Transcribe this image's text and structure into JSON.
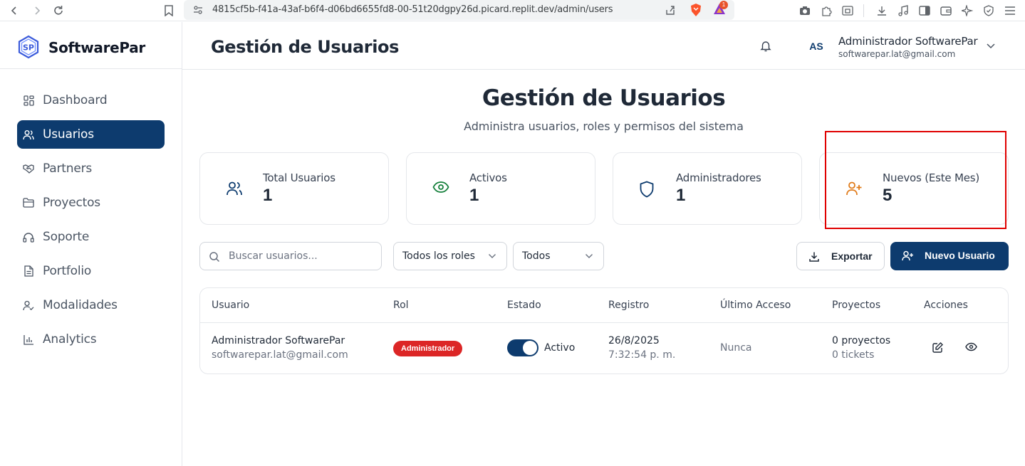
{
  "browser": {
    "url": "4815cf5b-f41a-43af-b6f4-d06bd6655fd8-00-51t20dgpy26d.picard.replit.dev/admin/users",
    "rewards_badge": "1"
  },
  "brand": {
    "name": "SoftwarePar",
    "logo_text": "SP"
  },
  "sidebar": {
    "items": [
      {
        "label": "Dashboard",
        "icon": "grid-icon"
      },
      {
        "label": "Usuarios",
        "icon": "users-icon",
        "active": true
      },
      {
        "label": "Partners",
        "icon": "handshake-icon"
      },
      {
        "label": "Proyectos",
        "icon": "folder-icon"
      },
      {
        "label": "Soporte",
        "icon": "headphones-icon"
      },
      {
        "label": "Portfolio",
        "icon": "document-icon"
      },
      {
        "label": "Modalidades",
        "icon": "user-check-icon"
      },
      {
        "label": "Analytics",
        "icon": "bar-chart-icon"
      }
    ]
  },
  "header": {
    "title": "Gestión de Usuarios",
    "avatar_initials": "AS",
    "user_name": "Administrador SoftwarePar",
    "user_email": "softwarepar.lat@gmail.com"
  },
  "page": {
    "title": "Gestión de Usuarios",
    "subtitle": "Administra usuarios, roles y permisos del sistema"
  },
  "stats": [
    {
      "label": "Total Usuarios",
      "value": "1",
      "icon": "users-icon",
      "color": "#0d3b6e"
    },
    {
      "label": "Activos",
      "value": "1",
      "icon": "eye-icon",
      "color": "#16803c"
    },
    {
      "label": "Administradores",
      "value": "1",
      "icon": "shield-icon",
      "color": "#0d3b6e"
    },
    {
      "label": "Nuevos (Este Mes)",
      "value": "5",
      "icon": "user-plus-icon",
      "color": "#e07b1a"
    }
  ],
  "filters": {
    "search_placeholder": "Buscar usuarios...",
    "role_filter": "Todos los roles",
    "status_filter": "Todos",
    "export_label": "Exportar",
    "new_user_label": "Nuevo Usuario"
  },
  "table": {
    "columns": [
      "Usuario",
      "Rol",
      "Estado",
      "Registro",
      "Último Acceso",
      "Proyectos",
      "Acciones"
    ],
    "rows": [
      {
        "name": "Administrador SoftwarePar",
        "email": "softwarepar.lat@gmail.com",
        "role": "Administrador",
        "status": "Activo",
        "active": true,
        "date": "26/8/2025",
        "time": "7:32:54 p. m.",
        "last_access": "Nunca",
        "projects": "0 proyectos",
        "tickets": "0 tickets"
      }
    ]
  },
  "colors": {
    "primary": "#0d3b6e",
    "danger": "#dc2626",
    "highlight": "#e00000"
  }
}
